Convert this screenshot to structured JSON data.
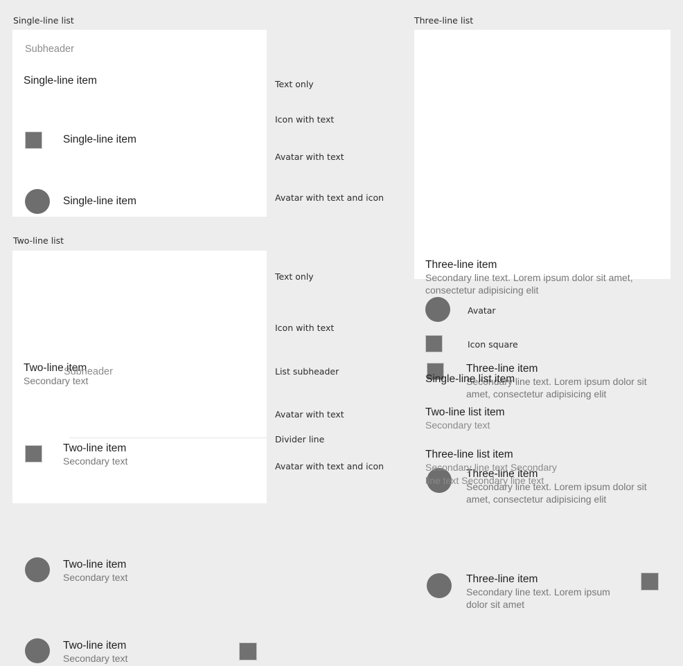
{
  "colors": {
    "page_background": "#ededed",
    "card_background": "#ffffff",
    "avatar_fill": "#6e6e6e",
    "icon_square_fill": "#717171",
    "icon_square_border": "#c9c9c9",
    "primary_text": "#212121",
    "secondary_text": "#777777",
    "subheader_text": "#8c8c8c",
    "divider": "#e4e4e4"
  },
  "sections": {
    "single_line": {
      "caption": "Single-line list",
      "subheader": "Subheader",
      "rows": [
        {
          "primary": "Single-line item",
          "annotation": "Text only"
        },
        {
          "primary": "Single-line item",
          "annotation": "Icon with text"
        },
        {
          "primary": "Single-line item",
          "annotation": "Avatar with text"
        },
        {
          "primary": "Single-line item",
          "annotation": "Avatar with text and icon"
        }
      ]
    },
    "two_line": {
      "caption": "Two-line list",
      "subheader": "Subheader",
      "rows": [
        {
          "primary": "Two-line item",
          "secondary": "Secondary text",
          "annotation": "Text only"
        },
        {
          "primary": "Two-line item",
          "secondary": "Secondary text",
          "annotation": "Icon with text"
        },
        {
          "primary": "Two-line item",
          "secondary": "Secondary text",
          "annotation": "Avatar with text"
        },
        {
          "primary": "Two-line item",
          "secondary": "Secondary text",
          "annotation": "Avatar with text and icon"
        }
      ],
      "subheader_annotation": "List subheader",
      "divider_annotation": "Divider line"
    },
    "three_line": {
      "caption": "Three-line list",
      "rows": [
        {
          "primary": "Three-line item",
          "secondary": "Secondary line text. Lorem ipsum dolor sit amet, consectetur adipisicing elit"
        },
        {
          "primary": "Three-line item",
          "secondary": "Secondary line text. Lorem ipsum dolor sit amet, consectetur adipisicing elit"
        },
        {
          "primary": "Three-line item",
          "secondary": "Secondary line text. Lorem ipsum dolor sit amet, consectetur adipisicing elit"
        },
        {
          "primary": "Three-line item",
          "secondary": "Secondary line text. Lorem ipsum dolor sit amet"
        }
      ]
    },
    "legend": {
      "avatar_label": "Avatar",
      "icon_square_label": "Icon square",
      "specimens": [
        {
          "primary": "Single-line list item",
          "secondary": ""
        },
        {
          "primary": "Two-line list item",
          "secondary": "Secondary text"
        },
        {
          "primary": "Three-line list item",
          "secondary": "Secondary line text Secondary line text Secondary line text"
        }
      ]
    }
  }
}
